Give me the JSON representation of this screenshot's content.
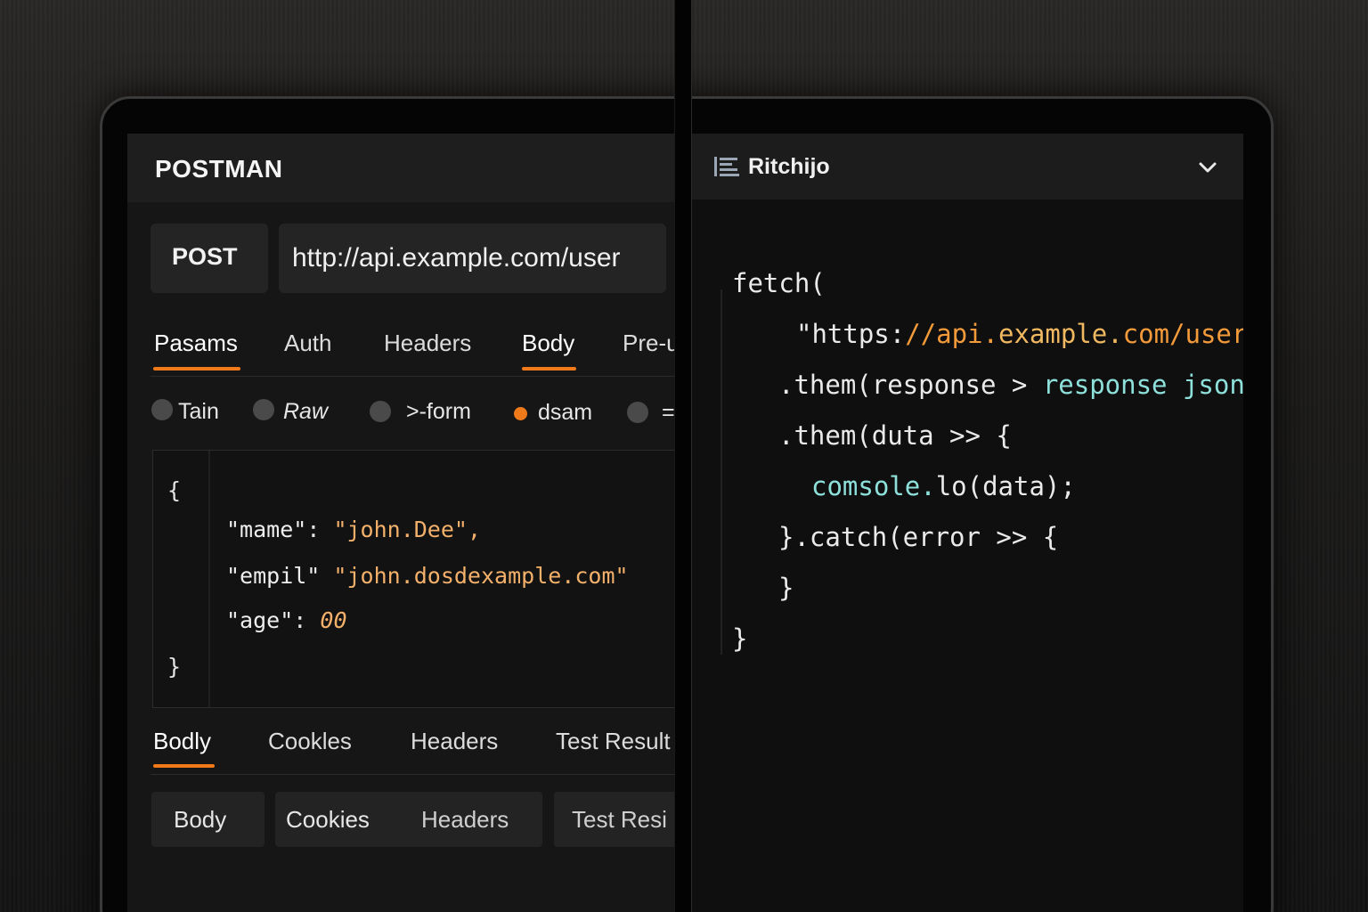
{
  "left_panel": {
    "app_title": "POSTMAN",
    "method": "POST",
    "url": "http://api.example.com/user",
    "request_tabs": [
      "Pasams",
      "Auth",
      "Headers",
      "Body",
      "Pre-u"
    ],
    "body_options": [
      "Tain",
      "Raw",
      ">-form",
      "dsam",
      "="
    ],
    "body_editor": {
      "open_brace": "{",
      "close_brace": "}",
      "line1_key": "\"mame\"",
      "line1_colon": ":",
      "line1_value": "\"john.Dee\",",
      "line2_key": "\"empil\"",
      "line2_value": "\"john.dosdexample.com\"",
      "line3_key": "\"age\"",
      "line3_colon": ":",
      "line3_value": "00"
    },
    "response_tabs": [
      "Bodly",
      "Cookles",
      "Headers",
      "Test Result"
    ],
    "response_subtabs": [
      "Body",
      "Cookies",
      "Headers",
      "Test Resi"
    ]
  },
  "right_panel": {
    "title": "Ritchijo",
    "icons": {
      "list": "list-icon",
      "chevron": "chevron-down-icon"
    },
    "code": {
      "l1": "fetch(",
      "l2_a": "\"https:",
      "l2_b": "//api.",
      "l2_c": "example.",
      "l2_d": "com/user",
      "l3_a": ".them(response > ",
      "l3_b": "response json",
      "l4": ".them(duta >> {",
      "l5_a": "comsole.",
      "l5_b": "lo(data);",
      "l6": "}.catch(error >> {",
      "l7": "}",
      "l8": "}"
    }
  },
  "colors": {
    "accent": "#f07a1a",
    "string": "#f3b06a",
    "cyan": "#8ee0da",
    "url_orange": "#f39a3a"
  }
}
